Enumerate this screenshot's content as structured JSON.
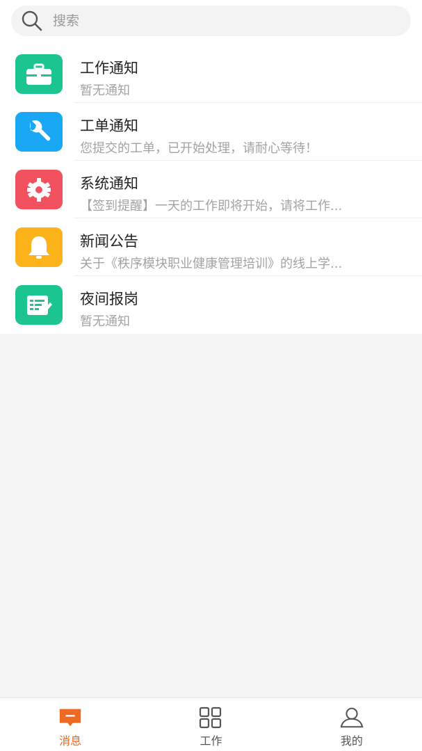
{
  "search": {
    "placeholder": "搜索"
  },
  "notifications": [
    {
      "title": "工作通知",
      "subtitle": "暂无通知",
      "icon": "briefcase-icon",
      "color": "#1cc48f"
    },
    {
      "title": "工单通知",
      "subtitle": "您提交的工单，已开始处理，请耐心等待！",
      "icon": "wrench-icon",
      "color": "#1aa7f5"
    },
    {
      "title": "系统通知",
      "subtitle": "【签到提醒】一天的工作即将开始，请将工作...",
      "icon": "gear-icon",
      "color": "#f2525f"
    },
    {
      "title": "新闻公告",
      "subtitle": "关于《秩序模块职业健康管理培训》的线上学...",
      "icon": "bell-icon",
      "color": "#fbb21b"
    },
    {
      "title": "夜间报岗",
      "subtitle": "暂无通知",
      "icon": "report-form-icon",
      "color": "#1cc48f"
    }
  ],
  "nav": {
    "active_color": "#ee6a23",
    "inactive_color": "#555555",
    "tabs": [
      {
        "label": "消息",
        "icon": "message-icon",
        "active": true
      },
      {
        "label": "工作",
        "icon": "grid-icon",
        "active": false
      },
      {
        "label": "我的",
        "icon": "user-icon",
        "active": false
      }
    ]
  }
}
